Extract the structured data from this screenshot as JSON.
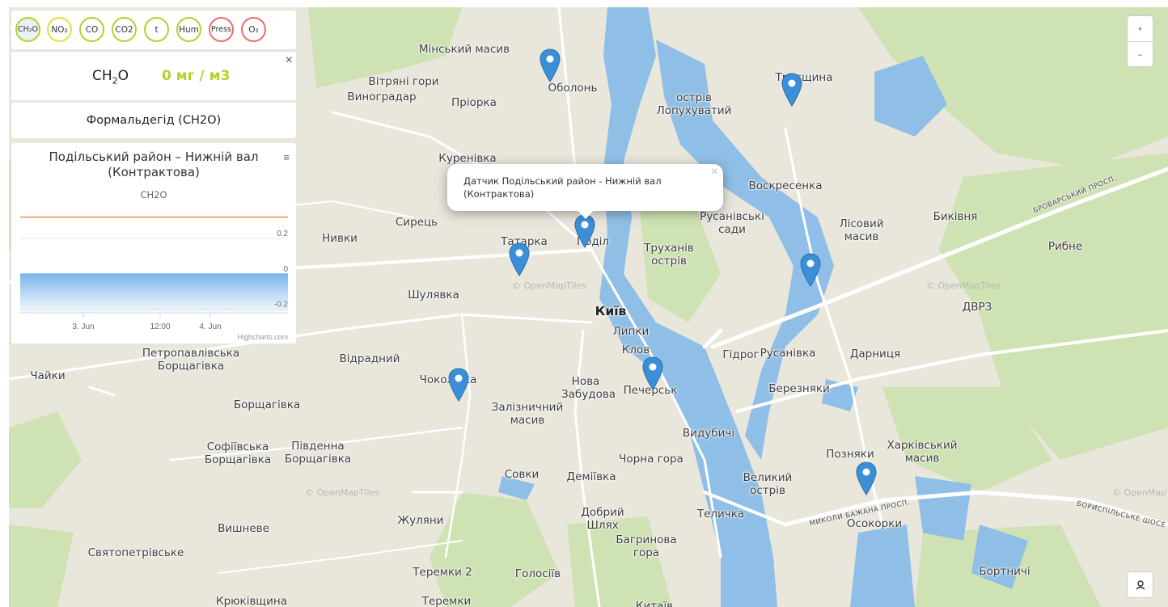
{
  "sensors": [
    {
      "label": "CH₂O",
      "active": true,
      "color": "#b4d22a"
    },
    {
      "label": "NO₂",
      "color": "#e5df3a"
    },
    {
      "label": "CO",
      "color": "#b4d22a"
    },
    {
      "label": "CO2",
      "color": "#b4d22a"
    },
    {
      "label": "t",
      "color": "#b4d22a"
    },
    {
      "label": "Hum",
      "color": "#b4d22a"
    },
    {
      "label": "Press",
      "color": "#f26b6b"
    },
    {
      "label": "O₂",
      "color": "#f26b6b"
    }
  ],
  "value_panel": {
    "formula_main": "CH",
    "formula_sub": "2",
    "formula_tail": "O",
    "reading": "0 мг / м3",
    "close": "×"
  },
  "pollutant_name": "Формальдегід (CH2O)",
  "chart": {
    "menu": "≡",
    "credits": "Highcharts.com"
  },
  "chart_data": {
    "type": "area",
    "title": "Подільський район – Нижній вал (Контрактова)",
    "subtitle": "CH2O",
    "x_ticks": [
      "3. Jun",
      "12:00",
      "4. Jun"
    ],
    "y_ticks": [
      0.2,
      0,
      -0.2
    ],
    "ylim": [
      -0.22,
      0.35
    ],
    "series": [
      {
        "name": "CH2O",
        "color": "#7cb5ec",
        "values": [
          0,
          0,
          0,
          0,
          0,
          0,
          0,
          0
        ]
      }
    ],
    "threshold_line": {
      "value": 0.32,
      "color": "#f0a868"
    }
  },
  "popup": {
    "text": "Датчик Подільський район - Нижній вал (Контрактова)",
    "close": "×"
  },
  "controls": {
    "zoom_in": "+",
    "zoom_out": "−"
  },
  "map": {
    "attribution": "© OpenMapTiles",
    "colors": {
      "land": "#e9e6dc",
      "water": "#8fbfe6",
      "forest": "#cfe2b3",
      "road": "#ffffff",
      "marker": "#3b8fd8"
    },
    "labels": {
      "l0": "Мінський масив",
      "l1": "Оболонь",
      "l2": "Вітряні гори",
      "l3": "Виноградар",
      "l4": "Пріорка",
      "l5": "острів Лопухуватий",
      "l6": "Троєщина",
      "l7": "Куренівка",
      "l8": "Воскресенка",
      "l9": "Сирець",
      "l10": "Татарка",
      "l11": "Поділ",
      "l12": "Русанівські сади",
      "l13": "Лісовий масив",
      "l14": "Биківня",
      "l15": "Нивки",
      "l16": "Труханів острів",
      "l17": "Рибне",
      "l18": "Шулявка",
      "l19": "Київ",
      "l20": "ДВРЗ",
      "l21": "Липки",
      "l22": "Петропавлівська Борщагівка",
      "l23": "Відрадний",
      "l24": "Клов",
      "l25": "Гідрог",
      "l26": "Русанівка",
      "l27": "Дарниця",
      "l28": "Чайки",
      "l29": "Чоколівка",
      "l30": "Нова Забудова",
      "l31": "Печерськ",
      "l32": "Березняки",
      "l33": "Борщагівка",
      "l34": "Залізничний масив",
      "l35": "Видубичі",
      "l36": "Софіївська Борщагівка",
      "l37": "Південна Борщагівка",
      "l38": "Позняки",
      "l39": "Харківський масив",
      "l40": "Чорна гора",
      "l41": "Совки",
      "l42": "Деміївка",
      "l43": "Великий острів",
      "l44": "Жуляни",
      "l45": "Добрий Шлях",
      "l46": "Теличка",
      "l47": "Осокорки",
      "l48": "Вишневе",
      "l49": "Багринова гора",
      "l50": "Святопетрівське",
      "l51": "Теремки 2",
      "l52": "Голосіїв",
      "l53": "Бортничі",
      "l54": "Крюківщина",
      "l55": "Теремки",
      "l56": "Китаїв"
    },
    "roads": {
      "r1": "БРОВАРСЬКИЙ ПРОСП.",
      "r2": "МИКОЛИ БАЖАНА ПРОСП.",
      "r3": "БОРИСПІЛЬСЬКЕ ШОСЕ"
    }
  }
}
